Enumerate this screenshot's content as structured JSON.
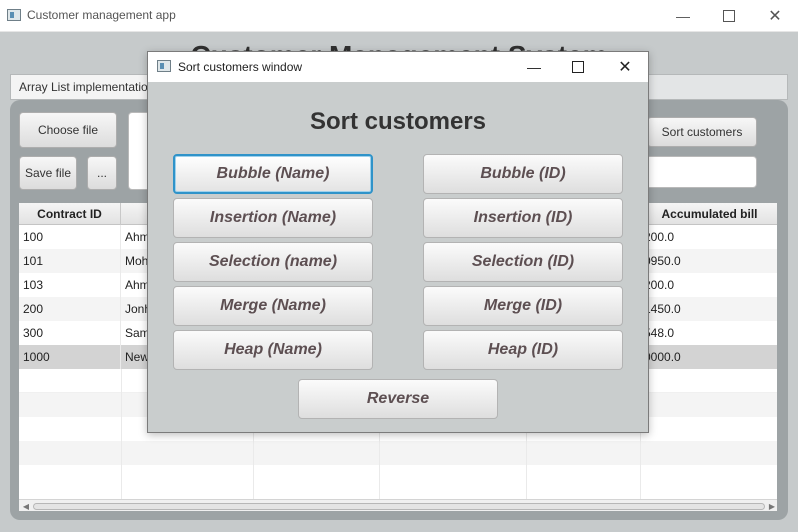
{
  "main_window": {
    "title": "Customer management app",
    "app_title": "Customer Management System",
    "tab_label": "Array List implementation",
    "choose_file_label": "Choose file",
    "save_file_label": "Save file",
    "more_label": "...",
    "sort_customers_label": "Sort customers",
    "table": {
      "headers": [
        "Contract ID",
        "",
        "",
        "",
        "",
        "Accumulated bill"
      ],
      "rows": [
        [
          "100",
          "Ahm",
          "",
          "",
          "",
          "200.0"
        ],
        [
          "101",
          "Moh",
          "",
          "",
          "",
          "0950.0"
        ],
        [
          "103",
          "Ahm",
          "",
          "",
          "",
          "200.0"
        ],
        [
          "200",
          "Jonh",
          "",
          "",
          "",
          "1450.0"
        ],
        [
          "300",
          "Sam",
          "",
          "",
          "",
          "548.0"
        ],
        [
          "1000",
          "New",
          "",
          "",
          "",
          "0000.0"
        ]
      ],
      "selected_row_index": 5
    }
  },
  "dialog": {
    "title": "Sort customers window",
    "heading": "Sort customers",
    "buttons": {
      "bubble_name": "Bubble (Name)",
      "bubble_id": "Bubble (ID)",
      "insertion_name": "Insertion (Name)",
      "insertion_id": "Insertion (ID)",
      "selection_name": "Selection (name)",
      "selection_id": "Selection (ID)",
      "merge_name": "Merge (Name)",
      "merge_id": "Merge (ID)",
      "heap_name": "Heap (Name)",
      "heap_id": "Heap (ID)",
      "reverse": "Reverse"
    },
    "focused_button": "bubble_name"
  },
  "icons": {
    "minimize": "minimize-icon",
    "maximize": "maximize-icon",
    "close": "close-icon",
    "app": "app-icon"
  },
  "colors": {
    "window_background": "#c6cacb",
    "panel_background": "#9da3a5",
    "dialog_background": "#c9cdcd",
    "button_text": "#5d4f52",
    "focus_border": "#2f93c9",
    "selected_row": "#d3d3d3"
  }
}
